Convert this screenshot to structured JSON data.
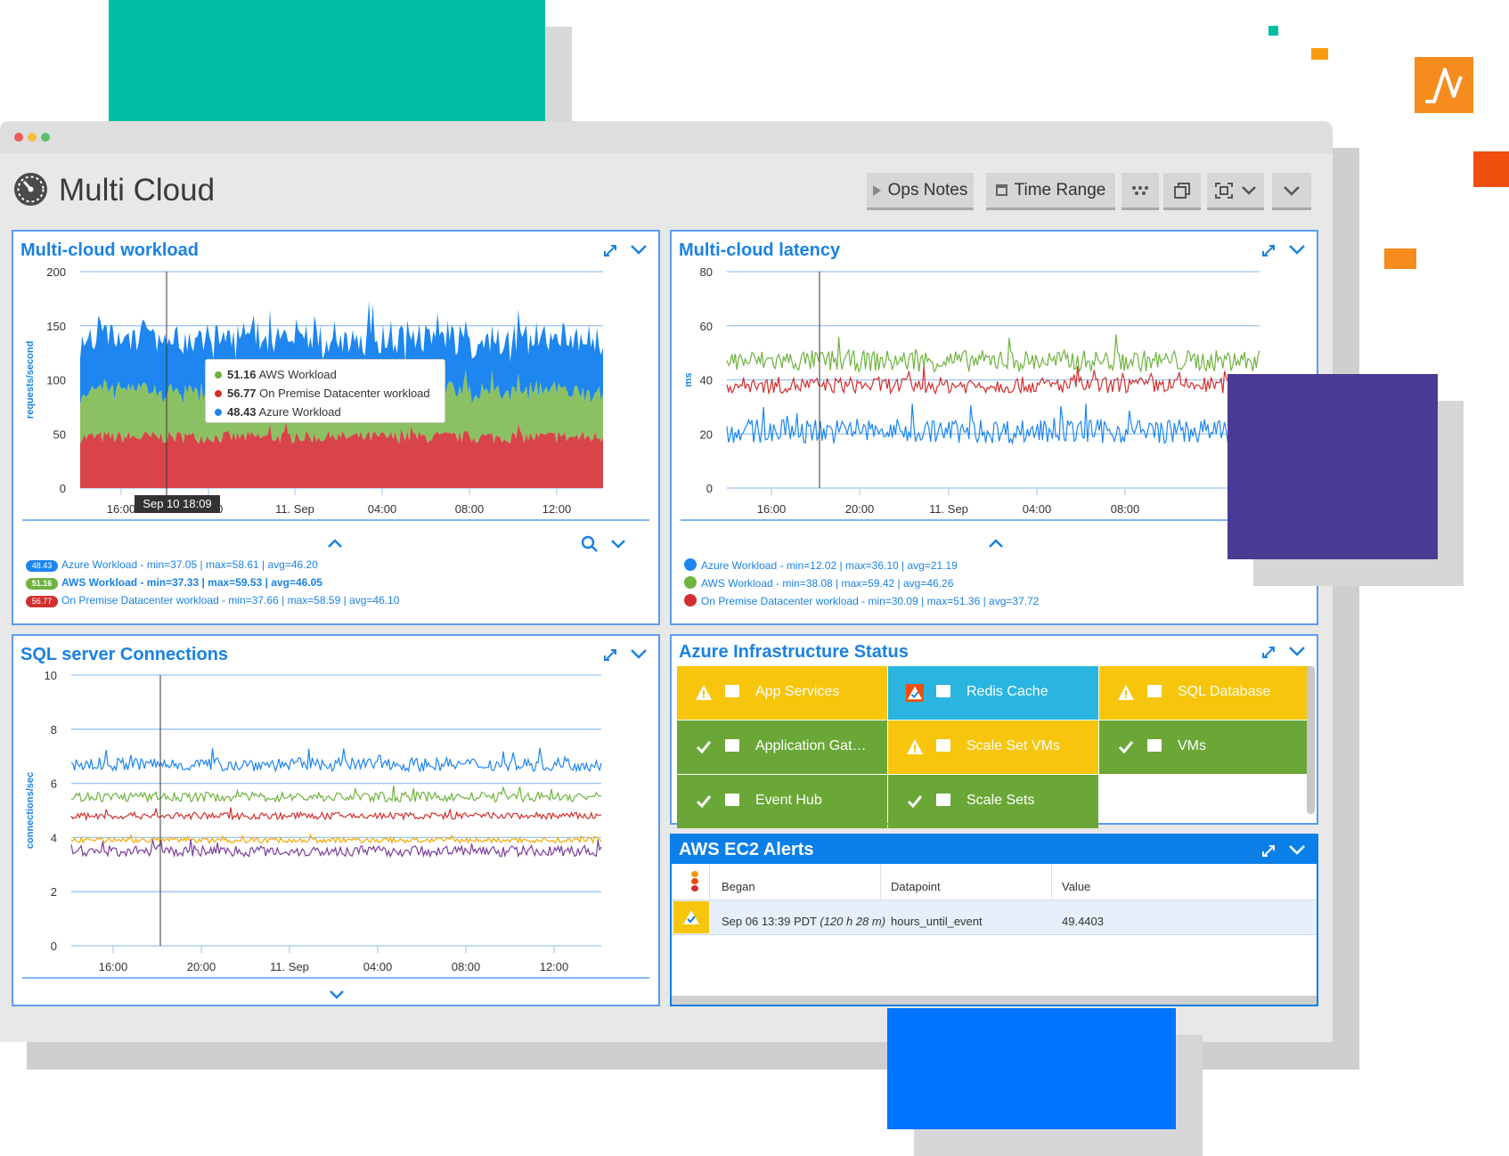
{
  "colors": {
    "teal": "#00bfa5",
    "orange": "#f79b0f",
    "purple": "#4a3a94",
    "blue": "#0073ff",
    "panel_title": "#1a82e2",
    "azure": "#1d86f0",
    "aws": "#6fb33f",
    "onprem": "#d32f2f",
    "warn": "#f7c50b",
    "ok": "#6aa737",
    "redis": "#29b5e0"
  },
  "app": {
    "title": "Multi Cloud"
  },
  "toolbar": {
    "ops_notes": "Ops Notes",
    "time_range": "Time Range"
  },
  "x_ticks": [
    "16:00",
    "20:00",
    "11. Sep",
    "04:00",
    "08:00",
    "12:00"
  ],
  "workload": {
    "title": "Multi-cloud workload",
    "ylabel": "requests/second",
    "y_ticks": [
      "200",
      "150",
      "100",
      "50",
      "0"
    ],
    "x_ticks": [
      "16:00",
      "20:00",
      "11. Sep",
      "04:00",
      "08:00",
      "12:00"
    ],
    "cursor_label": "Sep 10 18:09",
    "tooltip": [
      {
        "value": "51.16",
        "name": "AWS Workload"
      },
      {
        "value": "56.77",
        "name": "On Premise Datacenter workload"
      },
      {
        "value": "48.43",
        "name": "Azure Workload"
      }
    ],
    "legend": [
      {
        "badge": "48.43",
        "text": "Azure Workload - min=37.05 | max=58.61 | avg=46.20"
      },
      {
        "badge": "51.16",
        "text": "AWS Workload - min=37.33 | max=59.53 | avg=46.05"
      },
      {
        "badge": "56.77",
        "text": "On Premise Datacenter workload - min=37.66 | max=58.59 | avg=46.10"
      }
    ]
  },
  "latency": {
    "title": "Multi-cloud latency",
    "ylabel": "ms",
    "y_ticks": [
      "80",
      "60",
      "40",
      "20",
      "0"
    ],
    "x_ticks": [
      "16:00",
      "20:00",
      "11. Sep",
      "04:00",
      "08:00"
    ],
    "legend": [
      "Azure Workload - min=12.02 | max=36.10 | avg=21.19",
      "AWS Workload - min=38.08 | max=59.42 | avg=46.26",
      "On Premise Datacenter workload - min=30.09 | max=51.36 | avg=37.72"
    ]
  },
  "sql": {
    "title": "SQL server Connections",
    "ylabel": "connections/sec",
    "y_ticks": [
      "10",
      "8",
      "6",
      "4",
      "2",
      "0"
    ],
    "x_ticks": [
      "16:00",
      "20:00",
      "11. Sep",
      "04:00",
      "08:00",
      "12:00"
    ]
  },
  "azure_status": {
    "title": "Azure Infrastructure Status",
    "tiles": [
      {
        "label": "App Services",
        "state": "warn"
      },
      {
        "label": "Redis Cache",
        "state": "alert"
      },
      {
        "label": "SQL Database",
        "state": "warn"
      },
      {
        "label": "Application Gat…",
        "state": "ok"
      },
      {
        "label": "Scale Set VMs",
        "state": "warn"
      },
      {
        "label": "VMs",
        "state": "ok"
      },
      {
        "label": "Event Hub",
        "state": "ok"
      },
      {
        "label": "Scale Sets",
        "state": "ok"
      }
    ]
  },
  "alerts": {
    "title": "AWS EC2 Alerts",
    "columns": [
      "Began",
      "Datapoint",
      "Value"
    ],
    "rows": [
      {
        "began": "Sep 06 13:39 PDT",
        "duration": "(120 h 28 m)",
        "datapoint": "hours_until_event",
        "value": "49.4403"
      }
    ]
  }
}
